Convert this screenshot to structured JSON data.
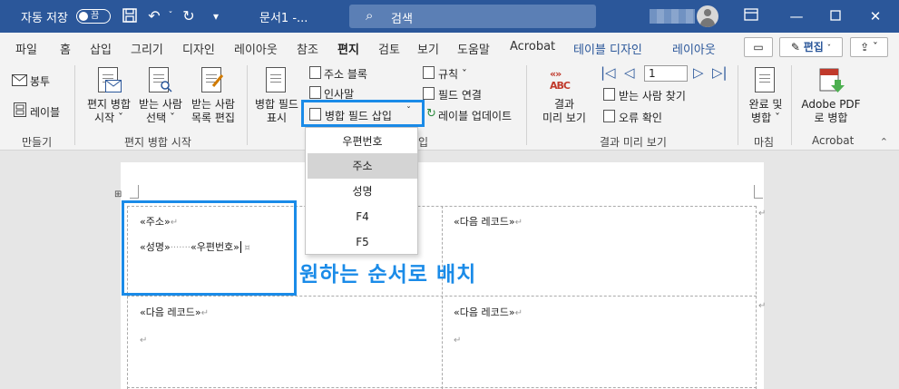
{
  "titlebar": {
    "autosave_label": "자동 저장",
    "autosave_state": "끔",
    "doc_title": "문서1  -...",
    "search_placeholder": "검색",
    "colors": {
      "bar": "#2b579a"
    }
  },
  "tabs": {
    "items": [
      "파일",
      "홈",
      "삽입",
      "그리기",
      "디자인",
      "레이아웃",
      "참조",
      "편지",
      "검토",
      "보기",
      "도움말",
      "Acrobat"
    ],
    "active": "편지",
    "context_tabs": [
      "테이블 디자인",
      "레이아웃"
    ],
    "edit_button": "편집",
    "edit_icon": "pencil-icon",
    "comment_icon": "comment-icon",
    "share_icon": "share-icon"
  },
  "ribbon": {
    "create": {
      "envelope": "봉투",
      "labels": "레이블",
      "group": "만들기"
    },
    "start": {
      "start_merge_1": "편지 병합",
      "start_merge_2": "시작 ˇ",
      "select_1": "받는 사람",
      "select_2": "선택 ˇ",
      "edit_1": "받는 사람",
      "edit_2": "목록 편집",
      "group": "편지 병합 시작"
    },
    "fields": {
      "highlight_1": "병합 필드",
      "highlight_2": "표시",
      "address_block": "주소 블록",
      "greeting": "인사말",
      "insert_field": "병합 필드 삽입",
      "rules": "규칙 ˇ",
      "match_fields": "필드 연결",
      "update_labels": "레이블 업데이트",
      "group_suffix": "입"
    },
    "preview": {
      "preview_1": "결과",
      "preview_2": "미리 보기",
      "record_number": "1",
      "find_recipient": "받는 사람 찾기",
      "check_errors": "오류 확인",
      "group": "결과 미리 보기"
    },
    "finish": {
      "finish_1": "완료 및",
      "finish_2": "병합 ˇ",
      "group": "마침"
    },
    "acrobat": {
      "pdf_1": "Adobe PDF",
      "pdf_2": "로 병합",
      "group": "Acrobat"
    }
  },
  "dropdown": {
    "items": [
      "우편번호",
      "주소",
      "성명",
      "F4",
      "F5"
    ],
    "selected": "주소"
  },
  "document": {
    "cell1_line1": "«주소»",
    "cell1_line2a": "«성명»",
    "cell1_line2b": "«우편번호»",
    "next_record": "«다음 레코드»",
    "caption": "원하는 순서로 배치",
    "accent": "#1a8be8"
  }
}
